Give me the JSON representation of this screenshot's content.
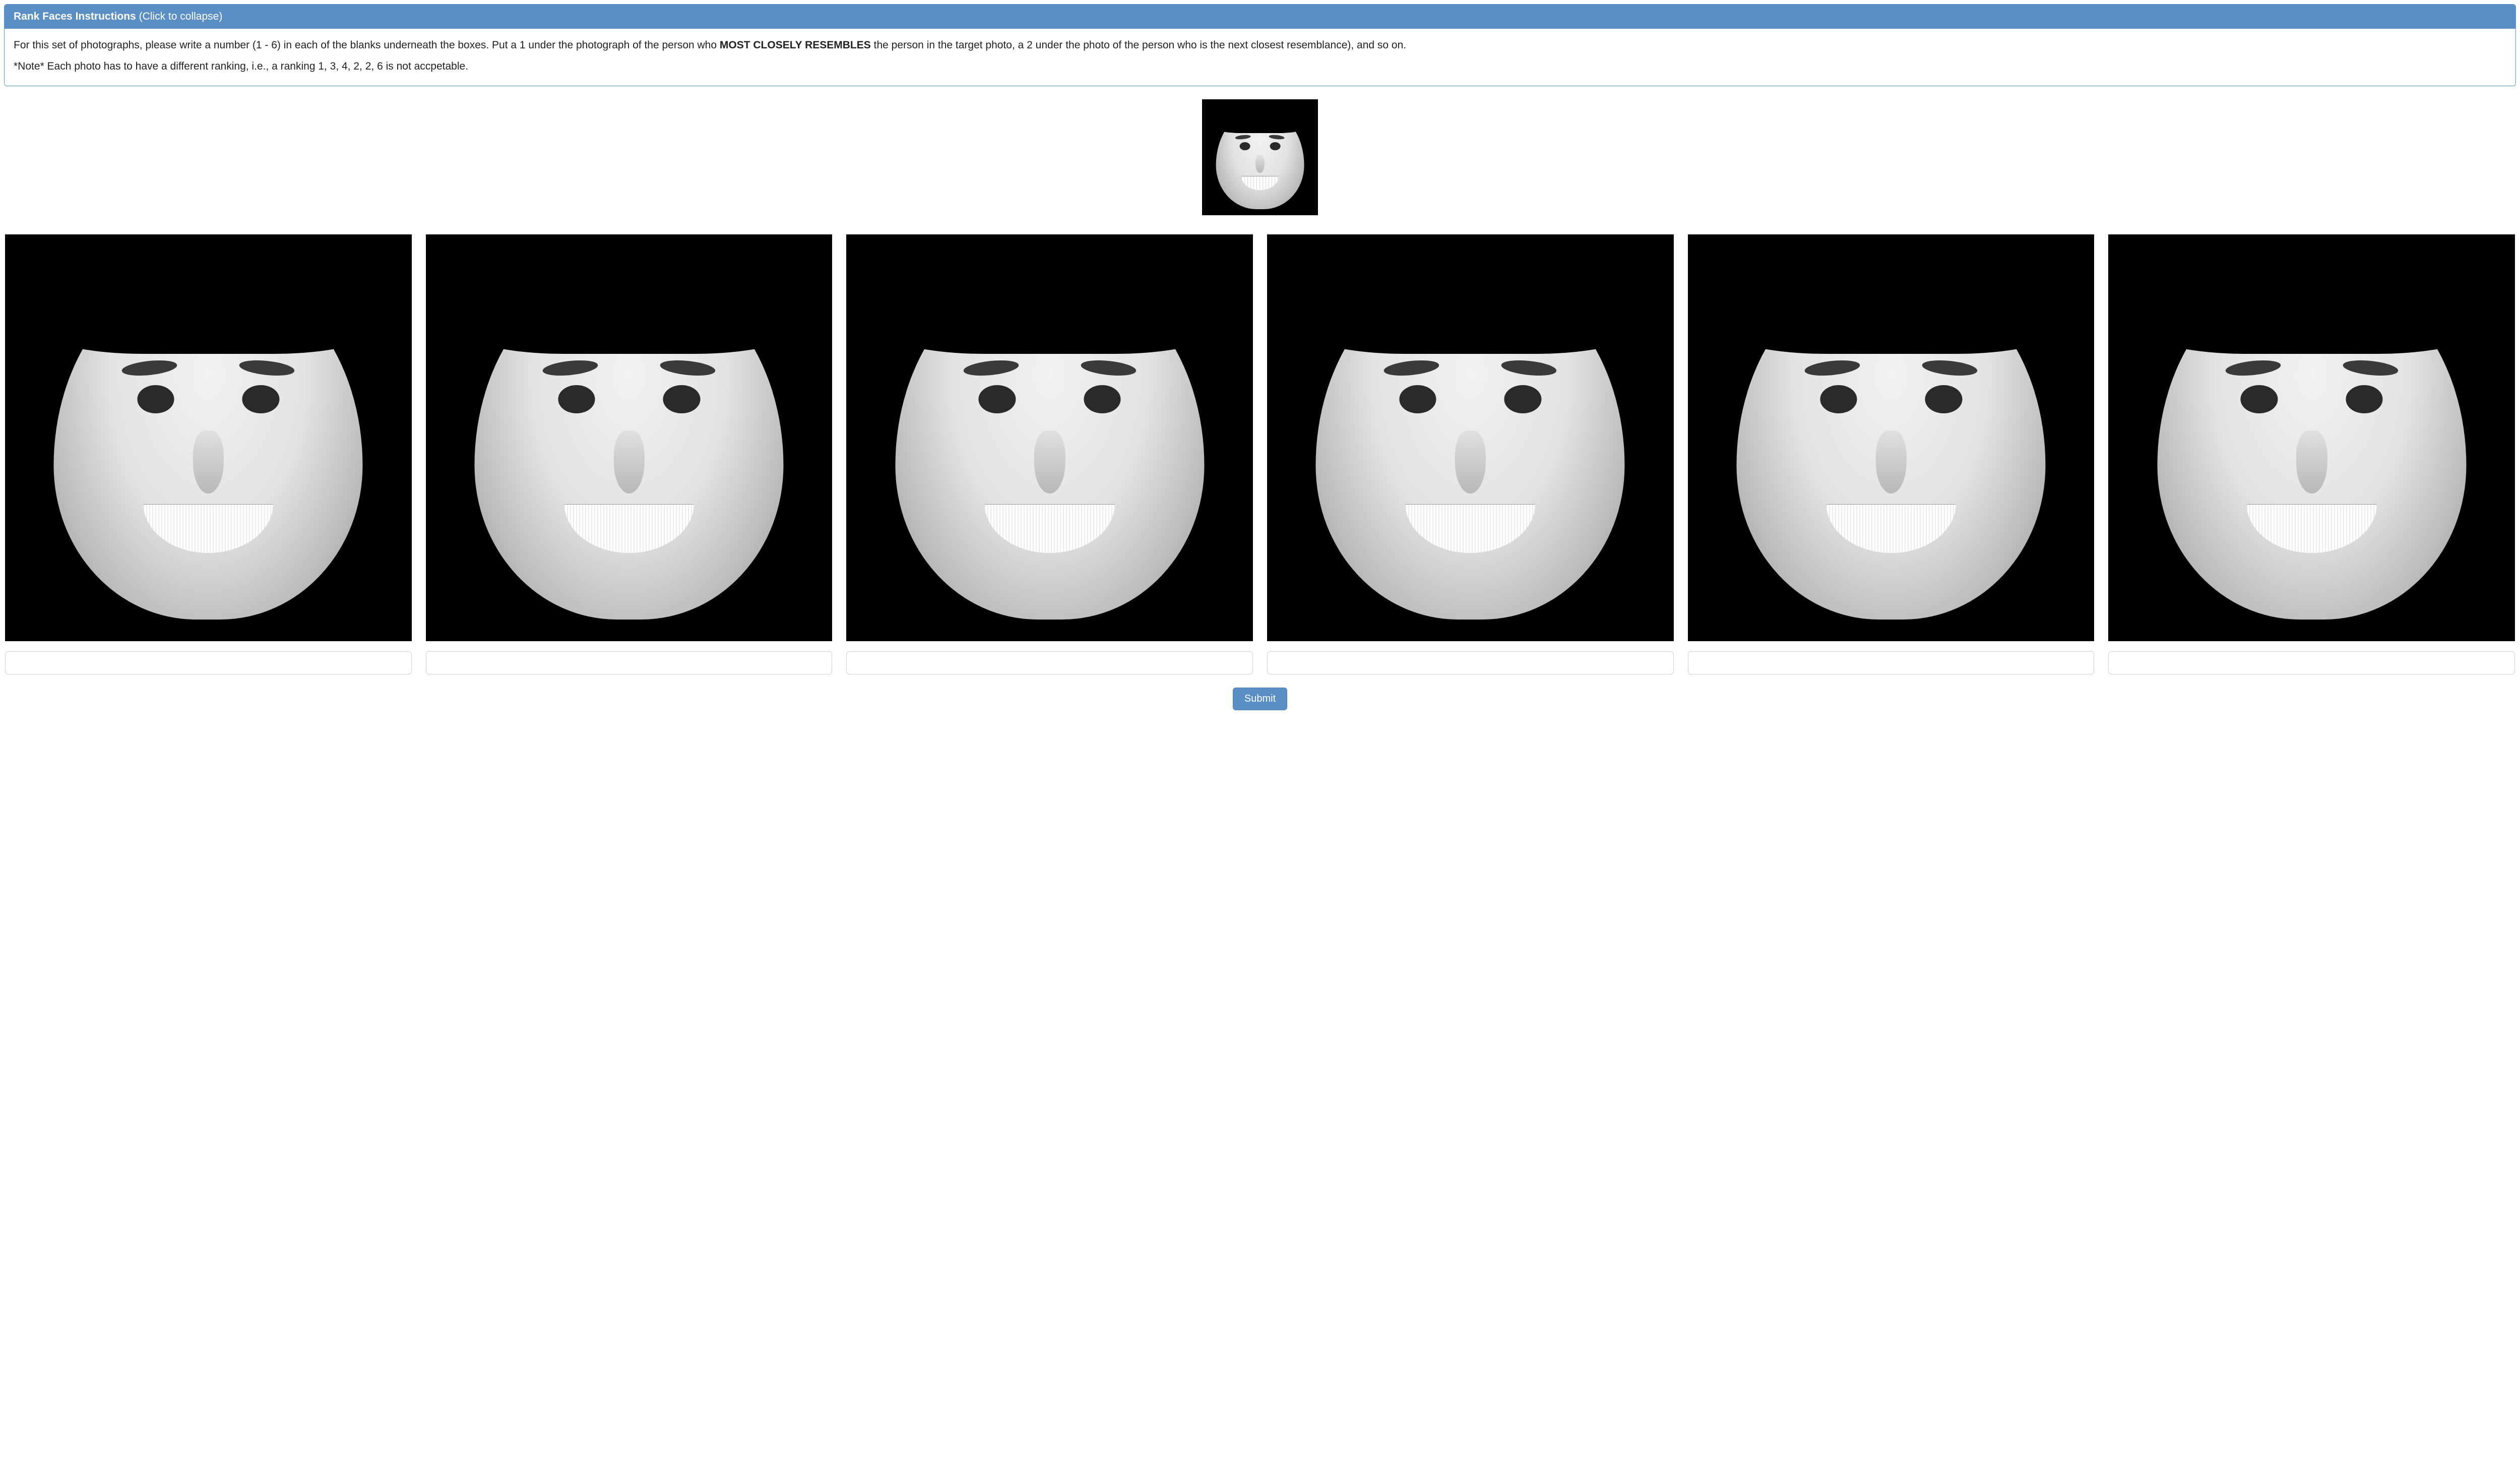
{
  "panel": {
    "title": "Rank Faces Instructions",
    "collapse_hint": "(Click to collapse)",
    "para1_before_bold": "For this set of photographs, please write a number (1 - 6) in each of the blanks underneath the boxes. Put a 1 under the photograph of the person who ",
    "para1_bold": "MOST CLOSELY RESEMBLES",
    "para1_after_bold": " the person in the target photo, a 2 under the photo of the person who is the next closest resemblance), and so on.",
    "para2": "*Note* Each photo has to have a different ranking, i.e., a ranking 1, 3, 4, 2, 2, 6 is not accpetable."
  },
  "target": {
    "alt": "Target face photograph"
  },
  "candidates": [
    {
      "alt": "Candidate face 1",
      "rank_value": ""
    },
    {
      "alt": "Candidate face 2",
      "rank_value": ""
    },
    {
      "alt": "Candidate face 3",
      "rank_value": ""
    },
    {
      "alt": "Candidate face 4",
      "rank_value": ""
    },
    {
      "alt": "Candidate face 5",
      "rank_value": ""
    },
    {
      "alt": "Candidate face 6",
      "rank_value": ""
    }
  ],
  "submit_label": "Submit"
}
